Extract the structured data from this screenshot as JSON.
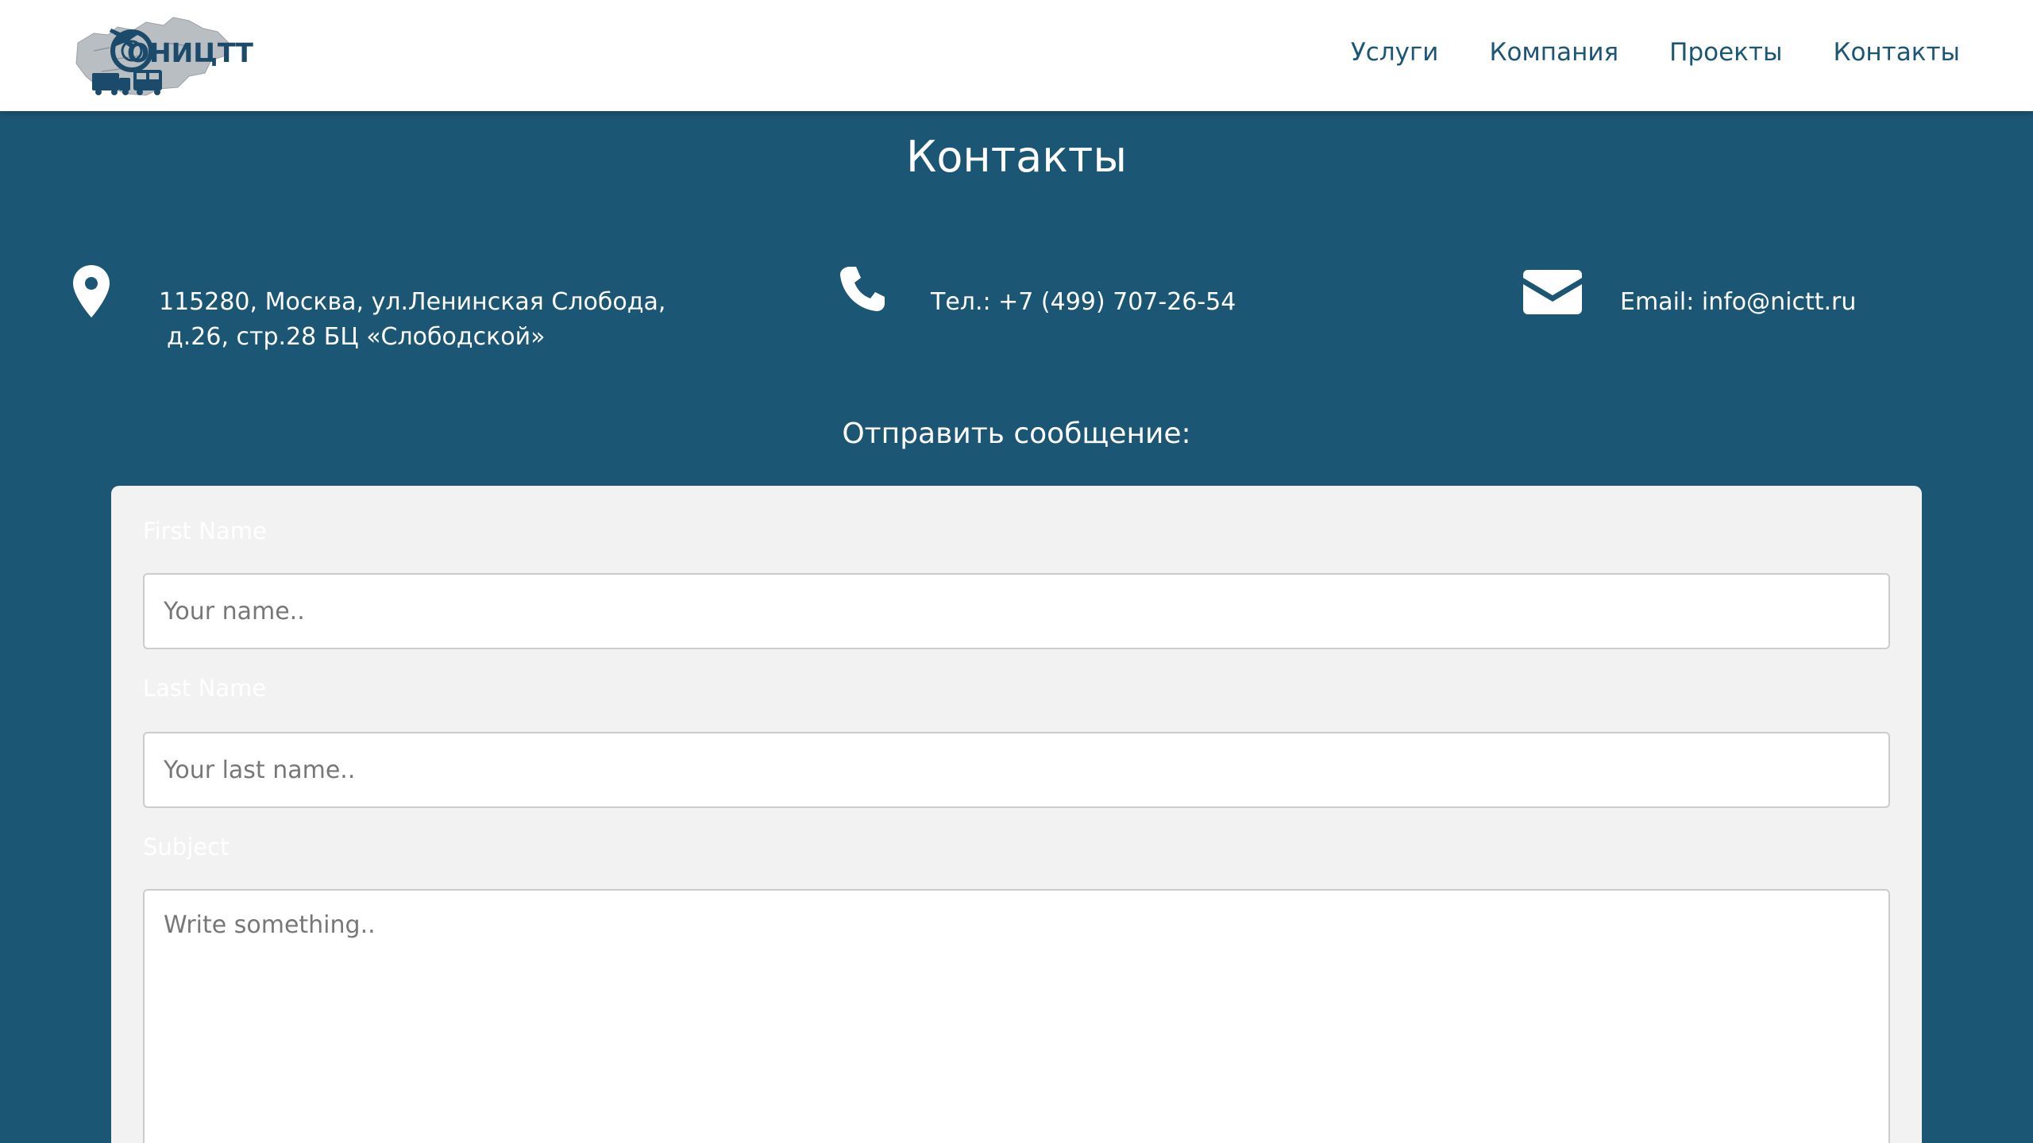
{
  "header": {
    "logo_text": "ОНИЦТТ",
    "nav": [
      {
        "label": "Услуги"
      },
      {
        "label": "Компания"
      },
      {
        "label": "Проекты"
      },
      {
        "label": "Контакты"
      }
    ]
  },
  "page": {
    "title": "Контакты"
  },
  "contacts": {
    "address_line1": "115280, Москва, ул.Ленинская Слобода,",
    "address_line2": "д.26, стр.28 БЦ «Слободской»",
    "phone": "Тел.: +7 (499) 707-26-54",
    "email": "Email: info@nictt.ru",
    "icons": [
      "map-marker-icon",
      "phone-icon",
      "envelope-icon"
    ]
  },
  "form": {
    "heading": "Отправить сообщение:",
    "first_name_label": "First Name",
    "first_name_placeholder": "Your name..",
    "last_name_label": "Last Name",
    "last_name_placeholder": "Your last name..",
    "subject_label": "Subject",
    "subject_placeholder": "Write something.."
  },
  "colors": {
    "primary": "#1b5675",
    "header_bg": "#ffffff",
    "form_bg": "#f2f2f2"
  }
}
